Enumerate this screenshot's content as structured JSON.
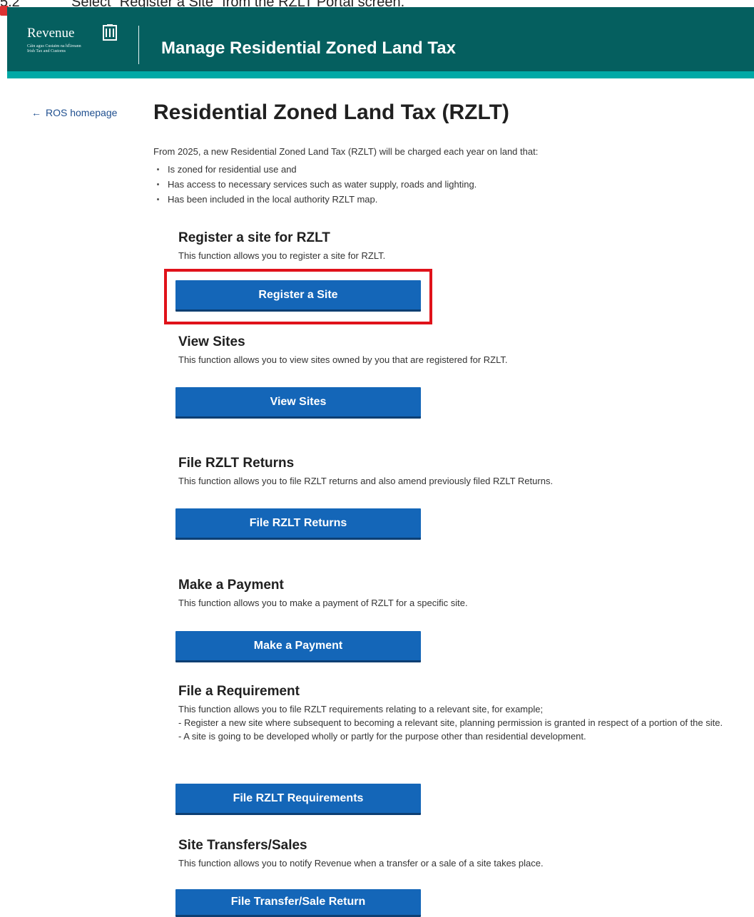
{
  "doc": {
    "step_number": "5.2",
    "caption": "Select “Register a Site” from the RZLT Portal screen."
  },
  "header": {
    "logo_word": "Revenue",
    "logo_sub_1": "Cáin agus Custaim na hÉireann",
    "logo_sub_2": "Irish Tax and Customs",
    "title": "Manage Residential Zoned Land Tax",
    "colors": {
      "primary": "#055f5f",
      "accent": "#00a9a6"
    }
  },
  "nav": {
    "back_label": "ROS homepage",
    "back_icon": "arrow-left-icon"
  },
  "page": {
    "title": "Residential Zoned Land Tax (RZLT)",
    "intro": "From 2025, a new Residential Zoned Land Tax (RZLT) will be charged each year on land that:",
    "bullets": [
      "Is zoned for residential use and",
      "Has access to necessary services such as water supply, roads and lighting.",
      "Has been included in the local authority RZLT map."
    ]
  },
  "sections": {
    "register": {
      "title": "Register a site for RZLT",
      "desc": "This function allows you to register a site for RZLT.",
      "button": "Register a Site"
    },
    "view": {
      "title": "View Sites",
      "desc": "This function allows you to view sites owned by you that are registered for RZLT.",
      "button": "View Sites"
    },
    "returns": {
      "title": "File RZLT Returns",
      "desc": "This function allows you to file RZLT returns and also amend previously filed RZLT Returns.",
      "button": "File RZLT Returns"
    },
    "payment": {
      "title": "Make a Payment",
      "desc": "This function allows you to make a payment of RZLT for a specific site.",
      "button": "Make a Payment"
    },
    "requirement": {
      "title": "File a Requirement",
      "desc_1": "This function allows you to file RZLT requirements relating to a relevant site, for example;",
      "desc_2": "- Register a new site where subsequent to becoming a relevant site, planning permission is granted in respect of a portion of the site.",
      "desc_3": "- A site is going to be developed wholly or partly for the purpose other than residential development.",
      "button": "File RZLT Requirements"
    },
    "transfers": {
      "title": "Site Transfers/Sales",
      "desc": "This function allows you to notify Revenue when a transfer or a sale of a site takes place.",
      "button": "File Transfer/Sale Return"
    }
  },
  "theme": {
    "button_color": "#1466b8",
    "highlight_color": "#e0121a"
  }
}
